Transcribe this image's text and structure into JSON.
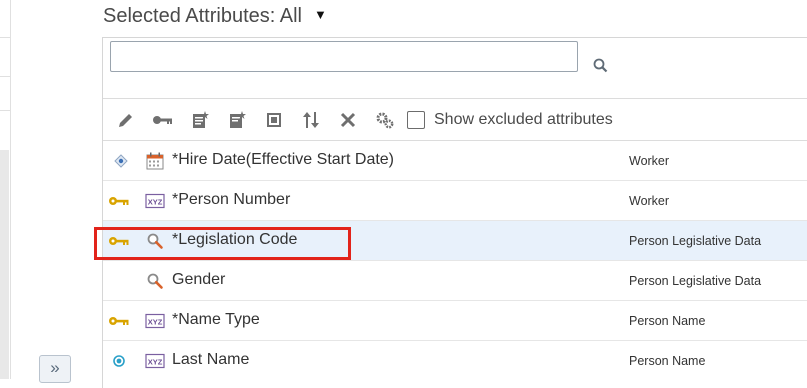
{
  "header": {
    "title": "Selected Attributes: All"
  },
  "search": {
    "value": "",
    "placeholder": ""
  },
  "toolbar": {
    "show_excluded_label": "Show excluded attributes",
    "show_excluded_checked": false
  },
  "rows": [
    {
      "lead_icon": "effective-date-icon",
      "type_icon": "calendar-icon",
      "name": "*Hire Date(Effective Start Date)",
      "object": "Worker",
      "selected": false
    },
    {
      "lead_icon": "key-icon",
      "type_icon": "text-type-icon",
      "name": "*Person Number",
      "object": "Worker",
      "selected": false
    },
    {
      "lead_icon": "key-icon",
      "type_icon": "lookup-icon",
      "name": "*Legislation Code",
      "object": "Person Legislative Data",
      "selected": true
    },
    {
      "lead_icon": "",
      "type_icon": "lookup-icon",
      "name": "Gender",
      "object": "Person Legislative Data",
      "selected": false
    },
    {
      "lead_icon": "key-icon",
      "type_icon": "text-type-icon",
      "name": "*Name Type",
      "object": "Person Name",
      "selected": false
    },
    {
      "lead_icon": "radio-icon",
      "type_icon": "text-type-icon",
      "name": "Last Name",
      "object": "Person Name",
      "selected": false
    }
  ],
  "colors": {
    "highlight": "#e2231a",
    "selected_row": "#e8f1fb",
    "key": "#d9a400"
  }
}
